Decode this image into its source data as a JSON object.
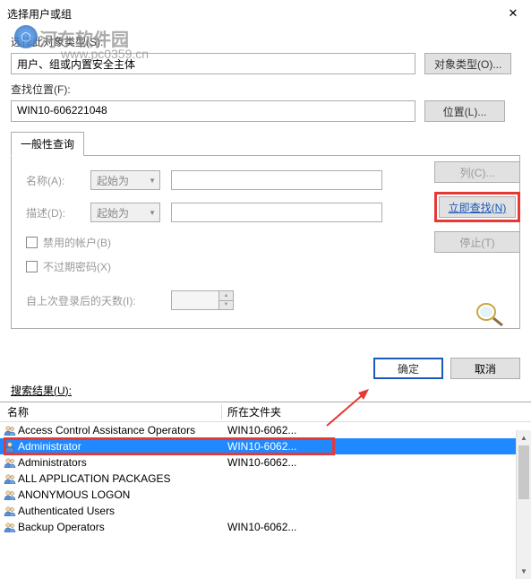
{
  "window": {
    "title": "选择用户或组"
  },
  "watermark": {
    "text": "河东软件园",
    "url": "www.pc0359.cn"
  },
  "objectType": {
    "label": "选择此对象类型(S):",
    "value": "用户、组或内置安全主体",
    "button": "对象类型(O)..."
  },
  "location": {
    "label": "查找位置(F):",
    "value": "WIN10-606221048",
    "button": "位置(L)..."
  },
  "tab": {
    "label": "一般性查询"
  },
  "query": {
    "name_label": "名称(A):",
    "name_combo": "起始为",
    "desc_label": "描述(D):",
    "desc_combo": "起始为",
    "cb_disabled": "禁用的帐户(B)",
    "cb_noexpire": "不过期密码(X)",
    "days_label": "自上次登录后的天数(I):"
  },
  "sideButtons": {
    "columns": "列(C)...",
    "findNow": "立即查找(N)",
    "stop": "停止(T)"
  },
  "dialogButtons": {
    "ok": "确定",
    "cancel": "取消"
  },
  "results": {
    "label_prefix": "搜索结果(",
    "label_u": "U",
    "label_suffix": "):",
    "col_name": "名称",
    "col_folder": "所在文件夹",
    "rows": [
      {
        "name": "Access Control Assistance Operators",
        "folder": "WIN10-6062..."
      },
      {
        "name": "Administrator",
        "folder": "WIN10-6062...",
        "selected": true
      },
      {
        "name": "Administrators",
        "folder": "WIN10-6062..."
      },
      {
        "name": "ALL APPLICATION PACKAGES",
        "folder": ""
      },
      {
        "name": "ANONYMOUS LOGON",
        "folder": ""
      },
      {
        "name": "Authenticated Users",
        "folder": ""
      },
      {
        "name": "Backup Operators",
        "folder": "WIN10-6062..."
      }
    ]
  }
}
